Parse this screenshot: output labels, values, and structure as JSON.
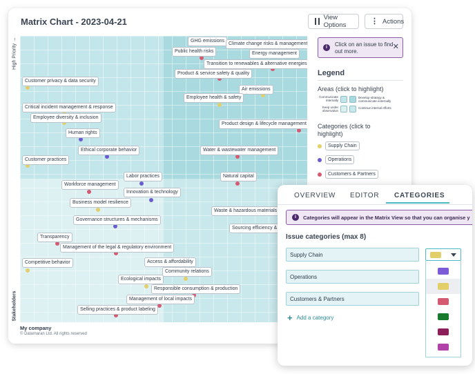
{
  "matrix_view": {
    "title": "Matrix Chart - 2023-04-21",
    "view_options_label": "View Options",
    "actions_label": "Actions",
    "y_axis_high_label": "High Priority →",
    "y_axis_low_label": "Stakeholders",
    "x_axis_label": "My company",
    "copyright": "© Datamaran Ltd. All rights reserved",
    "issues": [
      {
        "label": "GHG emissions",
        "category": "Operations"
      },
      {
        "label": "Climate change risks & management",
        "category": "Supply Chain"
      },
      {
        "label": "Public health risks",
        "category": "Customers & Partners"
      },
      {
        "label": "Energy management",
        "category": "Customers & Partners"
      },
      {
        "label": "Transition to renewables & alternative energies",
        "category": "Customers & Partners"
      },
      {
        "label": "Product & service safety & quality",
        "category": "Customers & Partners"
      },
      {
        "label": "Customer privacy & data security",
        "category": "Supply Chain"
      },
      {
        "label": "Air emissions",
        "category": "Supply Chain"
      },
      {
        "label": "Employee health & safety",
        "category": "Supply Chain"
      },
      {
        "label": "Critical incident management & response",
        "category": "Supply Chain"
      },
      {
        "label": "Employee diversity & inclusion",
        "category": "Supply Chain"
      },
      {
        "label": "Product design & lifecycle management",
        "category": "Customers & Partners"
      },
      {
        "label": "Human rights",
        "category": "Operations"
      },
      {
        "label": "Ethical corporate behavior",
        "category": "Operations"
      },
      {
        "label": "Water & wastewater management",
        "category": "Customers & Partners"
      },
      {
        "label": "Customer practices",
        "category": "Supply Chain"
      },
      {
        "label": "Labor practices",
        "category": "Operations"
      },
      {
        "label": "Natural capital",
        "category": "Customers & Partners"
      },
      {
        "label": "Workforce management",
        "category": "Customers & Partners"
      },
      {
        "label": "Innovation & technology",
        "category": "Operations"
      },
      {
        "label": "Business model resilience",
        "category": "Supply Chain"
      },
      {
        "label": "Waste & hazardous materials m",
        "category": "Customers & Partners"
      },
      {
        "label": "Governance structures & mechanisms",
        "category": "Operations"
      },
      {
        "label": "Sourcing efficiency & r",
        "category": "Customers & Partners"
      },
      {
        "label": "Transparency",
        "category": "Customers & Partners"
      },
      {
        "label": "Management of the legal & regulatory environment",
        "category": "Customers & Partners"
      },
      {
        "label": "Competitive behavior",
        "category": "Supply Chain"
      },
      {
        "label": "Access & affordability",
        "category": "Supply Chain"
      },
      {
        "label": "Community relations",
        "category": "Supply Chain"
      },
      {
        "label": "Ecological impacts",
        "category": "Supply Chain"
      },
      {
        "label": "Responsible consumption & production",
        "category": "Customers & Partners"
      },
      {
        "label": "Management of local impacts",
        "category": "Customers & Partners"
      },
      {
        "label": "Selling practices & product labeling",
        "category": "Customers & Partners"
      }
    ]
  },
  "info_box": {
    "text": "Click on an issue to find out more.",
    "close": "✕"
  },
  "legend": {
    "title": "Legend",
    "areas_title": "Areas (click to highlight)",
    "areas": [
      {
        "label": "Communicate internally"
      },
      {
        "label": "Develop strategy & communicate externally"
      },
      {
        "label": "Keep under observation"
      },
      {
        "label": "Continue internal efforts"
      }
    ],
    "categories_title": "Categories (click to highlight)",
    "categories": [
      {
        "label": "Supply Chain",
        "color": "#e2cf6a"
      },
      {
        "label": "Operations",
        "color": "#6a5cd0"
      },
      {
        "label": "Customers & Partners",
        "color": "#d45a72"
      }
    ]
  },
  "panel": {
    "tabs": [
      {
        "label": "OVERVIEW",
        "active": false
      },
      {
        "label": "EDITOR",
        "active": false
      },
      {
        "label": "CATEGORIES",
        "active": true
      }
    ],
    "info": "Categories will appear in the Matrix View so that you can organise y",
    "section_title": "Issue categories (max 8)",
    "category_inputs": [
      "Supply Chain",
      "Operations",
      "Customers & Partners"
    ],
    "selected_color": "#e2cf6a",
    "color_options": [
      "#7b5cd6",
      "#e2cf6a",
      "#d45a72",
      "#187a2c",
      "#8c1f5a",
      "#b042a8"
    ],
    "add_label": "Add a category"
  },
  "colors": {
    "accent_teal": "#4bb8c4",
    "info_purple": "#8a5aa8"
  }
}
